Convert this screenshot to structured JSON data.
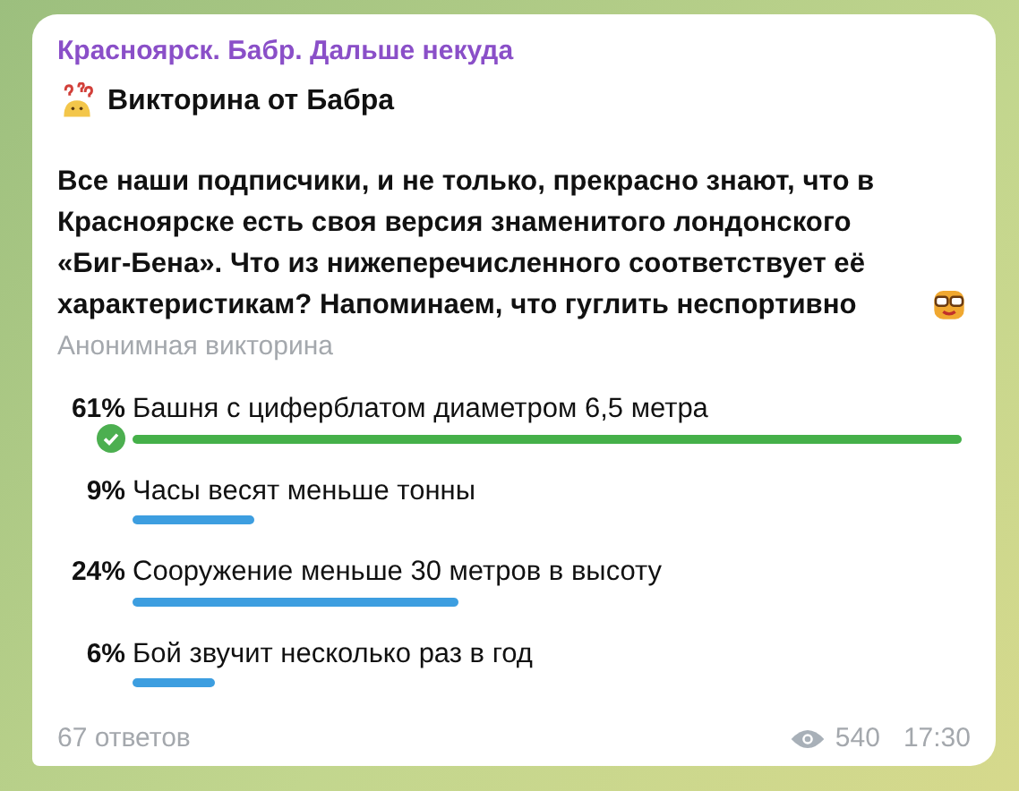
{
  "channel": {
    "name": "Красноярск. Бабр. Дальше некуда"
  },
  "quiz": {
    "title": "Викторина от Бабра",
    "question": "Все наши подписчики, и не только, прекрасно знают, что в Красноярске есть своя версия знаменитого лондонского «Биг-Бена». Что из нижеперечисленного соответствует её характеристикам? Напоминаем, что гуглить неспортивно",
    "type": "Анонимная викторина",
    "options": [
      {
        "percent": "61%",
        "text": "Башня с циферблатом диаметром 6,5 метра",
        "correct": true
      },
      {
        "percent": "9%",
        "text": "Часы весят меньше тонны",
        "correct": false
      },
      {
        "percent": "24%",
        "text": "Сооружение меньше 30 метров в высоту",
        "correct": false
      },
      {
        "percent": "6%",
        "text": "Бой звучит несколько раз в год",
        "correct": false
      }
    ],
    "answers": "67 ответов"
  },
  "footer": {
    "views": "540",
    "time": "17:30"
  }
}
